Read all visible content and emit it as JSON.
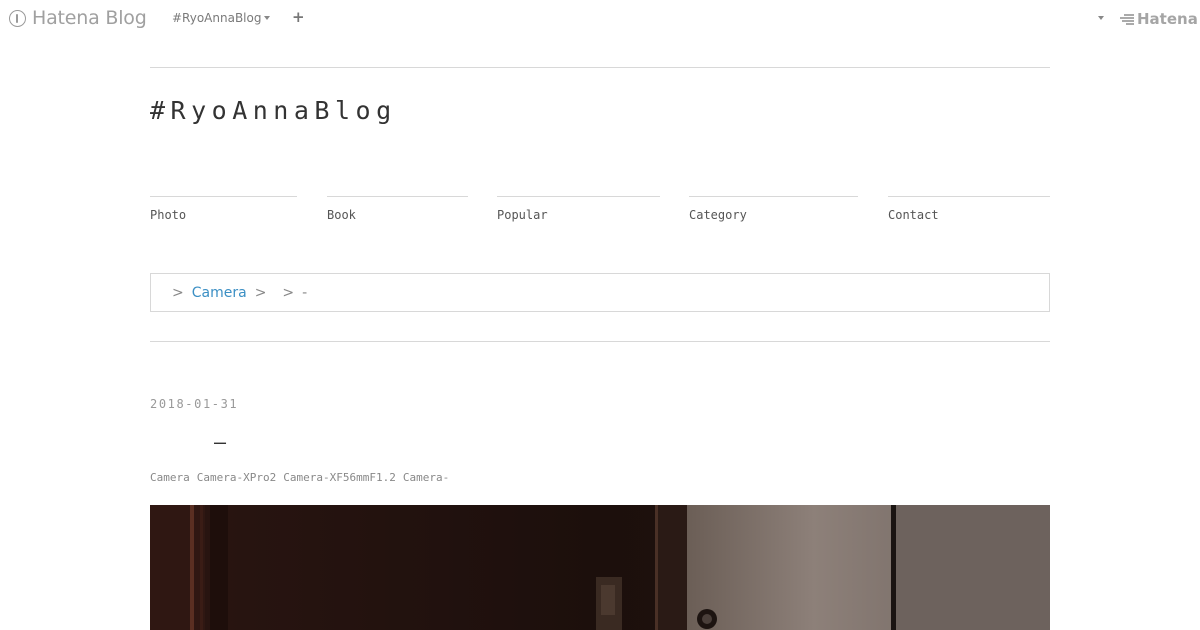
{
  "topbar": {
    "logo_text": "Hatena Blog",
    "blog_selector": "#RyoAnnaBlog",
    "add_button": "+",
    "brand_text": "Hatena"
  },
  "blog": {
    "title": "#RyoAnnaBlog"
  },
  "nav": {
    "items": [
      {
        "label": "Photo"
      },
      {
        "label": "Book"
      },
      {
        "label": "Popular"
      },
      {
        "label": "Category"
      },
      {
        "label": "Contact"
      }
    ]
  },
  "breadcrumb": {
    "sep": ">",
    "link": "Camera",
    "tail": "-"
  },
  "entry": {
    "date": "2018-01-31",
    "title": "–",
    "categories": [
      "Camera",
      "Camera-XPro2",
      "Camera-XF56mmF1.2",
      "Camera-"
    ]
  },
  "colors": {
    "link": "#3b8fc4",
    "border": "#d8d8d8"
  }
}
